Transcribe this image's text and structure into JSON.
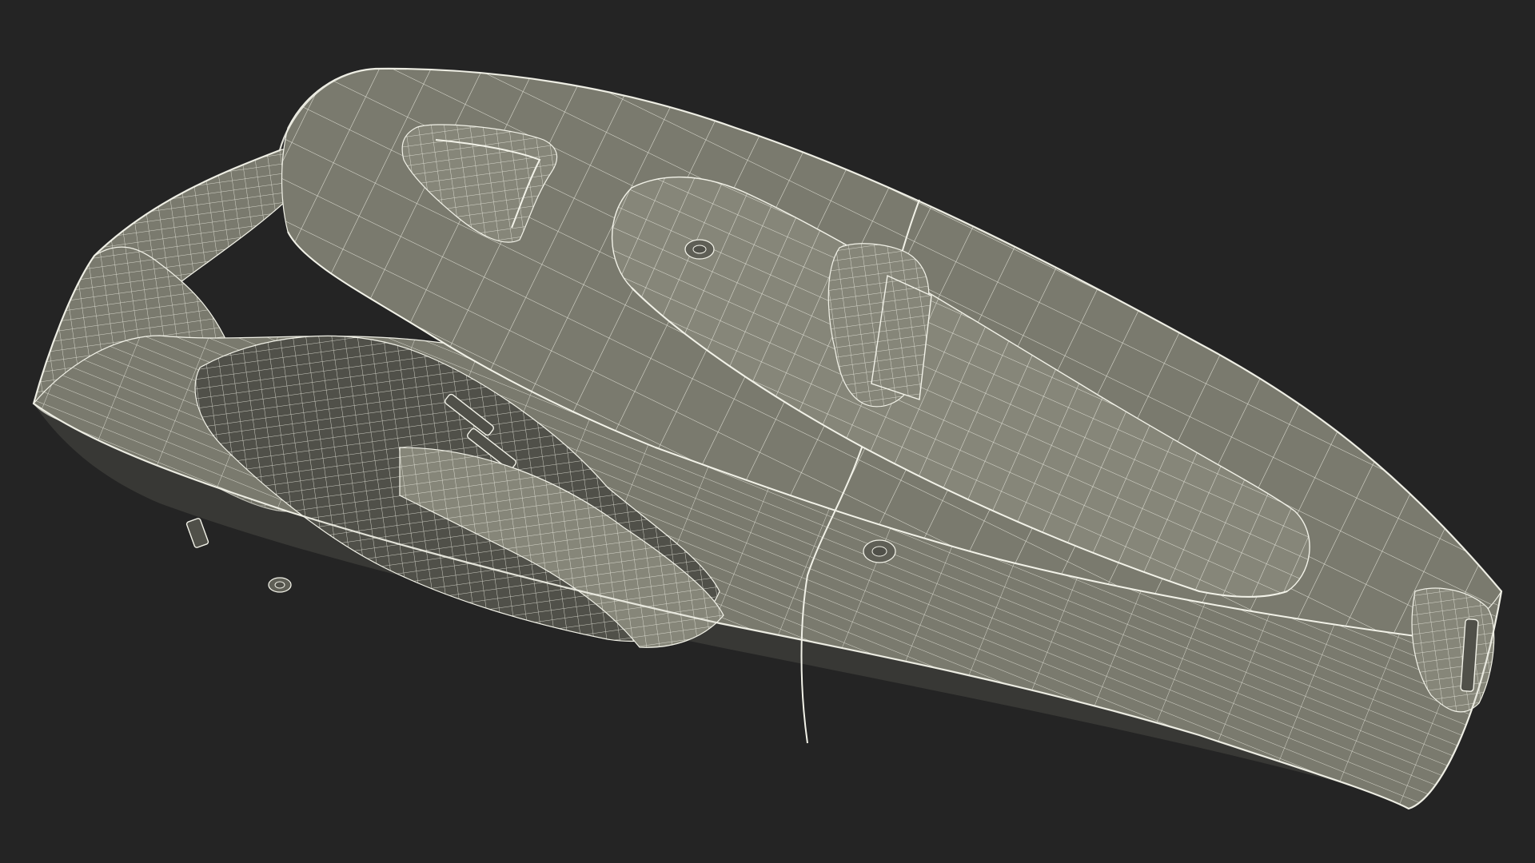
{
  "scene": {
    "subject": "handheld-vacuum-wireframe",
    "colors": {
      "background": "#242424",
      "surface": "#7a7a6e",
      "surface_light": "#868679",
      "surface_dark": "#5f5f56",
      "cavity": "#505049",
      "wire": "#f2f2e8"
    }
  }
}
